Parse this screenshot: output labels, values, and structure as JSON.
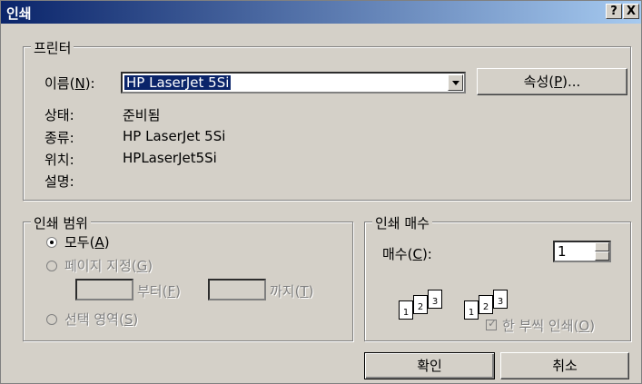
{
  "title": "인쇄",
  "title_buttons": {
    "help": "?",
    "close": "X"
  },
  "printer": {
    "legend": "프린터",
    "name_label_pre": "이름(",
    "name_label_key": "N",
    "name_label_post": "):",
    "name_value": "HP LaserJet 5Si",
    "properties_pre": "속성(",
    "properties_key": "P",
    "properties_post": ")...",
    "status_label": "상태:",
    "status_value": "준비됨",
    "type_label": "종류:",
    "type_value": "HP LaserJet 5Si",
    "location_label": "위치:",
    "location_value": "HPLaserJet5Si",
    "comment_label": "설명:"
  },
  "range": {
    "legend": "인쇄 범위",
    "all_pre": "모두(",
    "all_key": "A",
    "all_post": ")",
    "pages_pre": "페이지 지정(",
    "pages_key": "G",
    "pages_post": ")",
    "from_pre": "부터(",
    "from_key": "F",
    "from_post": ")",
    "to_pre": "까지(",
    "to_key": "T",
    "to_post": ")",
    "selection_pre": "선택 영역(",
    "selection_key": "S",
    "selection_post": ")"
  },
  "copies": {
    "legend": "인쇄 매수",
    "count_pre": "매수(",
    "count_key": "C",
    "count_post": "):",
    "count_value": "1",
    "collate_pre": "한 부씩 인쇄(",
    "collate_key": "O",
    "collate_post": ")",
    "page_labels": [
      "1",
      "2",
      "3"
    ]
  },
  "buttons": {
    "ok": "확인",
    "cancel": "취소"
  }
}
